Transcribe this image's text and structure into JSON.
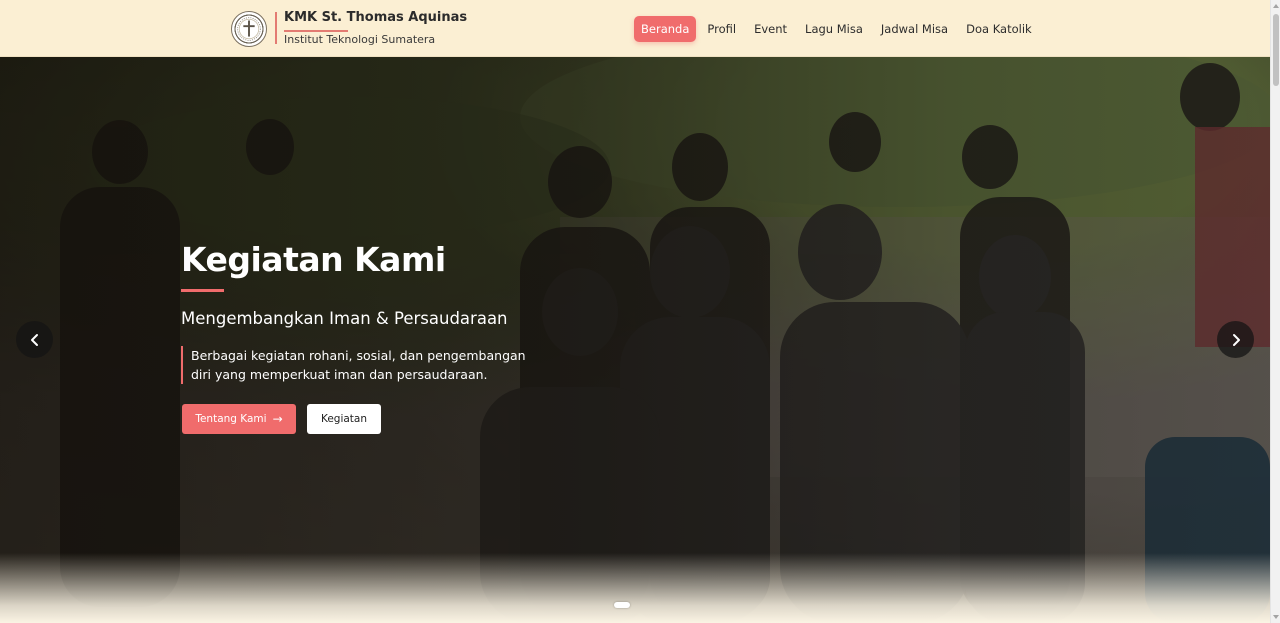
{
  "header": {
    "brand_title": "KMK St. Thomas Aquinas",
    "brand_subtitle": "Institut Teknologi Sumatera",
    "nav": [
      {
        "label": "Beranda",
        "active": true
      },
      {
        "label": "Profil",
        "active": false
      },
      {
        "label": "Event",
        "active": false
      },
      {
        "label": "Lagu Misa",
        "active": false
      },
      {
        "label": "Jadwal Misa",
        "active": false
      },
      {
        "label": "Doa Katolik",
        "active": false
      }
    ]
  },
  "hero": {
    "title": "Kegiatan Kami",
    "subtitle": "Mengembangkan Iman & Persaudaraan",
    "description": "Berbagai kegiatan rohani, sosial, dan pengembangan diri yang memperkuat iman dan persaudaraan.",
    "primary_button": "Tentang Kami",
    "secondary_button": "Kegiatan",
    "arrow_glyph": "→"
  },
  "colors": {
    "accent": "#f06c6c",
    "header_bg": "#fbefd3",
    "page_bg": "#fbf4e4"
  },
  "icons": [
    "logo-seal-icon",
    "chevron-left-icon",
    "chevron-right-icon",
    "arrow-right-icon"
  ]
}
